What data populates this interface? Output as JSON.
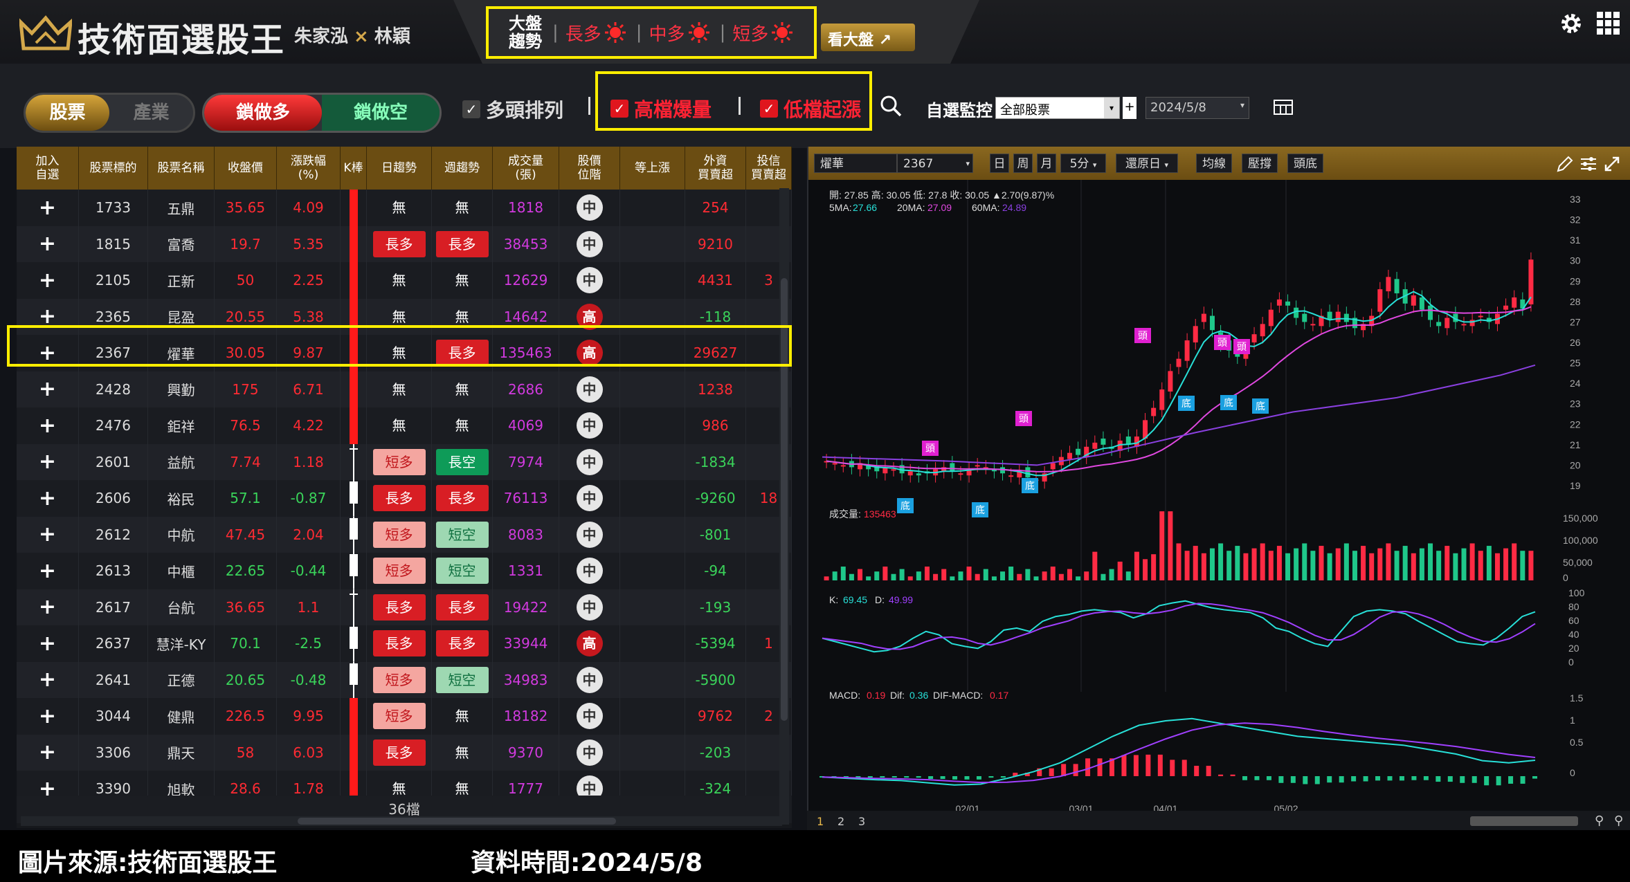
{
  "header": {
    "title": "技術面選股王",
    "author_a": "朱家泓",
    "author_x": "×",
    "author_b": "林穎",
    "market_label_1": "大盤",
    "market_label_2": "趨勢",
    "trends": [
      "長多",
      "中多",
      "短多"
    ],
    "view_market": "看大盤"
  },
  "toolbar": {
    "tab_stock": "股票",
    "tab_industry": "產業",
    "tab_lock_long": "鎖做多",
    "tab_lock_short": "鎖做空",
    "bull_align": "多頭排列",
    "high_volume": "高檔爆量",
    "low_rise": "低檔起漲",
    "watch_label": "自選監控",
    "watch_value": "全部股票",
    "date_value": "2024/5/8"
  },
  "table": {
    "headers": [
      "加入\n自選",
      "股票標的",
      "股票名稱",
      "收盤價",
      "漲跌幅\n(%)",
      "K棒",
      "日趨勢",
      "週趨勢",
      "成交量\n(張)",
      "股價\n位階",
      "等上漲",
      "外資\n買賣超",
      "投信\n買賣超"
    ],
    "rows": [
      {
        "code": "1733",
        "name": "五鼎",
        "close": "35.65",
        "chg": "4.09",
        "up": true,
        "k": "up",
        "day": "無",
        "week": "無",
        "vol": "1818",
        "pos": "中",
        "foreign": "254",
        "trust": ""
      },
      {
        "code": "1815",
        "name": "富喬",
        "close": "19.7",
        "chg": "5.35",
        "up": true,
        "k": "up",
        "day": "長多",
        "week": "長多",
        "vol": "38453",
        "pos": "中",
        "foreign": "9210",
        "trust": ""
      },
      {
        "code": "2105",
        "name": "正新",
        "close": "50",
        "chg": "2.25",
        "up": true,
        "k": "up",
        "day": "無",
        "week": "無",
        "vol": "12629",
        "pos": "中",
        "foreign": "4431",
        "trust": "3"
      },
      {
        "code": "2365",
        "name": "昆盈",
        "close": "20.55",
        "chg": "5.38",
        "up": true,
        "k": "up",
        "day": "無",
        "week": "無",
        "vol": "14642",
        "pos": "高",
        "foreign": "-118",
        "trust": ""
      },
      {
        "code": "2367",
        "name": "燿華",
        "close": "30.05",
        "chg": "9.87",
        "up": true,
        "k": "up",
        "day": "無",
        "week": "長多",
        "vol": "135463",
        "pos": "高",
        "foreign": "29627",
        "trust": ""
      },
      {
        "code": "2428",
        "name": "興勤",
        "close": "175",
        "chg": "6.71",
        "up": true,
        "k": "up",
        "day": "無",
        "week": "無",
        "vol": "2686",
        "pos": "中",
        "foreign": "1238",
        "trust": ""
      },
      {
        "code": "2476",
        "name": "鉅祥",
        "close": "76.5",
        "chg": "4.22",
        "up": true,
        "k": "up",
        "day": "無",
        "week": "無",
        "vol": "4069",
        "pos": "中",
        "foreign": "986",
        "trust": ""
      },
      {
        "code": "2601",
        "name": "益航",
        "close": "7.74",
        "chg": "1.18",
        "up": true,
        "k": "cross",
        "day": "短多",
        "week": "長空",
        "vol": "7974",
        "pos": "中",
        "foreign": "-1834",
        "trust": ""
      },
      {
        "code": "2606",
        "name": "裕民",
        "close": "57.1",
        "chg": "-0.87",
        "up": false,
        "k": "down",
        "day": "長多",
        "week": "長多",
        "vol": "76113",
        "pos": "中",
        "foreign": "-9260",
        "trust": "18"
      },
      {
        "code": "2612",
        "name": "中航",
        "close": "47.45",
        "chg": "2.04",
        "up": true,
        "k": "down",
        "day": "短多",
        "week": "短空",
        "vol": "8083",
        "pos": "中",
        "foreign": "-801",
        "trust": ""
      },
      {
        "code": "2613",
        "name": "中櫃",
        "close": "22.65",
        "chg": "-0.44",
        "up": false,
        "k": "down",
        "day": "短多",
        "week": "短空",
        "vol": "1331",
        "pos": "中",
        "foreign": "-94",
        "trust": ""
      },
      {
        "code": "2617",
        "name": "台航",
        "close": "36.65",
        "chg": "1.1",
        "up": true,
        "k": "cross",
        "day": "長多",
        "week": "長多",
        "vol": "19422",
        "pos": "中",
        "foreign": "-193",
        "trust": ""
      },
      {
        "code": "2637",
        "name": "慧洋-KY",
        "close": "70.1",
        "chg": "-2.5",
        "up": false,
        "k": "down",
        "day": "長多",
        "week": "長多",
        "vol": "33944",
        "pos": "高",
        "foreign": "-5394",
        "trust": "1"
      },
      {
        "code": "2641",
        "name": "正德",
        "close": "20.65",
        "chg": "-0.48",
        "up": false,
        "k": "down",
        "day": "短多",
        "week": "短空",
        "vol": "34983",
        "pos": "中",
        "foreign": "-5900",
        "trust": ""
      },
      {
        "code": "3044",
        "name": "健鼎",
        "close": "226.5",
        "chg": "9.95",
        "up": true,
        "k": "up",
        "day": "短多",
        "week": "無",
        "vol": "18182",
        "pos": "中",
        "foreign": "9762",
        "trust": "2"
      },
      {
        "code": "3306",
        "name": "鼎天",
        "close": "58",
        "chg": "6.03",
        "up": true,
        "k": "up",
        "day": "長多",
        "week": "無",
        "vol": "9370",
        "pos": "中",
        "foreign": "-203",
        "trust": ""
      },
      {
        "code": "3390",
        "name": "旭軟",
        "close": "28.6",
        "chg": "1.78",
        "up": true,
        "k": "up",
        "day": "無",
        "week": "無",
        "vol": "1777",
        "pos": "中",
        "foreign": "-324",
        "trust": ""
      }
    ],
    "count": "36檔"
  },
  "chart": {
    "symbol_name": "燿華",
    "symbol_code": "2367",
    "btn_day": "日",
    "btn_week": "周",
    "btn_month": "月",
    "btn_5min": "5分",
    "btn_restore": "還原日",
    "btn_ma": "均線",
    "btn_pressure": "壓撐",
    "btn_topbottom": "頭底",
    "ohlc_line": "開: 27.85  高: 30.05  低: 27.8  收: 30.05  ▲2.70(9.87)%",
    "ma5_label": "5MA:",
    "ma5": "27.66",
    "ma20_label": "20MA:",
    "ma20": "27.09",
    "ma60_label": "60MA:",
    "ma60": "24.89",
    "vol_label": "成交量:",
    "vol_value": "135463",
    "k_label": "K:",
    "k_value": "69.45",
    "d_label": "D:",
    "d_value": "49.99",
    "macd_label": "MACD:",
    "macd_value": "0.19",
    "dif_label": "Dif:",
    "dif_value": "0.36",
    "difmacd_label": "DIF-MACD:",
    "difmacd_value": "0.17",
    "price_ticks": [
      "33",
      "32",
      "31",
      "30",
      "29",
      "28",
      "27",
      "26",
      "25",
      "24",
      "23",
      "22",
      "21",
      "20",
      "19"
    ],
    "vol_ticks": [
      "150,000",
      "100,000",
      "50,000",
      "0"
    ],
    "kd_ticks": [
      "100",
      "80",
      "60",
      "40",
      "20",
      "0"
    ],
    "macd_ticks": [
      "1.5",
      "1",
      "0.5",
      "0"
    ],
    "x_ticks": [
      "02/01",
      "03/01",
      "04/01",
      "05/02"
    ],
    "top_mark": "頭",
    "bottom_mark": "底",
    "pages": [
      "1",
      "2",
      "3"
    ],
    "colors": {
      "up": "#ff2b44",
      "down": "#1fc78a",
      "ma5": "#28e0d8",
      "ma20": "#e048e0",
      "ma60": "#8a40e0",
      "k": "#28e0d8",
      "d": "#a040ff"
    }
  },
  "caption": {
    "source": "圖片來源:技術面選股王",
    "time": "資料時間:2024/5/8"
  }
}
